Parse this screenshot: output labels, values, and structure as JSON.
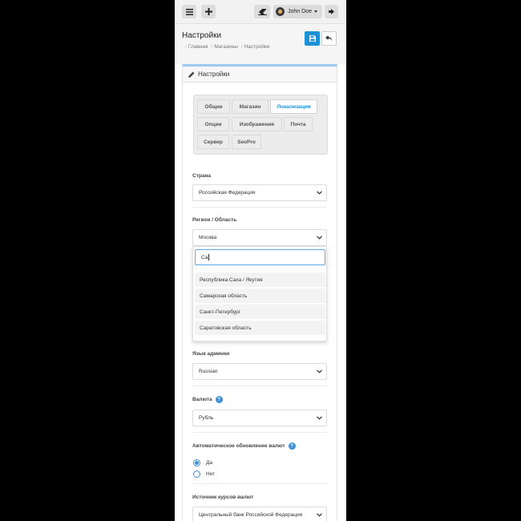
{
  "topbar": {
    "user_name": "John Doe",
    "icons": [
      "menu-icon",
      "plus-icon",
      "eraser-icon",
      "avatar-icon",
      "logout-icon"
    ]
  },
  "header": {
    "title": "Настройки",
    "breadcrumb": [
      "Главная",
      "Магазины",
      "Настройки"
    ]
  },
  "panel": {
    "title": "Настройки"
  },
  "tabs": [
    {
      "label": "Общие",
      "active": false
    },
    {
      "label": "Магазин",
      "active": false
    },
    {
      "label": "Локализация",
      "active": true
    },
    {
      "label": "Опции",
      "active": false
    },
    {
      "label": "Изображения",
      "active": false
    },
    {
      "label": "Почта",
      "active": false
    },
    {
      "label": "Сервер",
      "active": false
    },
    {
      "label": "SeoPro",
      "active": false
    }
  ],
  "fields": {
    "country": {
      "label": "Страна",
      "value": "Российская Федерация"
    },
    "region": {
      "label": "Регион / Область",
      "value": "Москва"
    },
    "admin_language": {
      "label": "Язык админки",
      "value": "Russian"
    },
    "currency": {
      "label": "Валюта",
      "value": "Рубль",
      "help": "?"
    },
    "auto_update": {
      "label": "Автоматическое обновление валют",
      "help": "?",
      "options": [
        "Да",
        "Нет"
      ],
      "selected": "Да"
    },
    "rates_source": {
      "label": "Источник курсов валют",
      "value": "Центральный банк Российской Федерации"
    }
  },
  "region_dropdown": {
    "search_value": "Са",
    "options": [
      "Республика Саха / Якутия",
      "Самарская область",
      "Санкт-Петербург",
      "Саратовская область"
    ]
  },
  "colors": {
    "accent": "#1e91d6",
    "panel_top_border": "#9fc7ef"
  }
}
